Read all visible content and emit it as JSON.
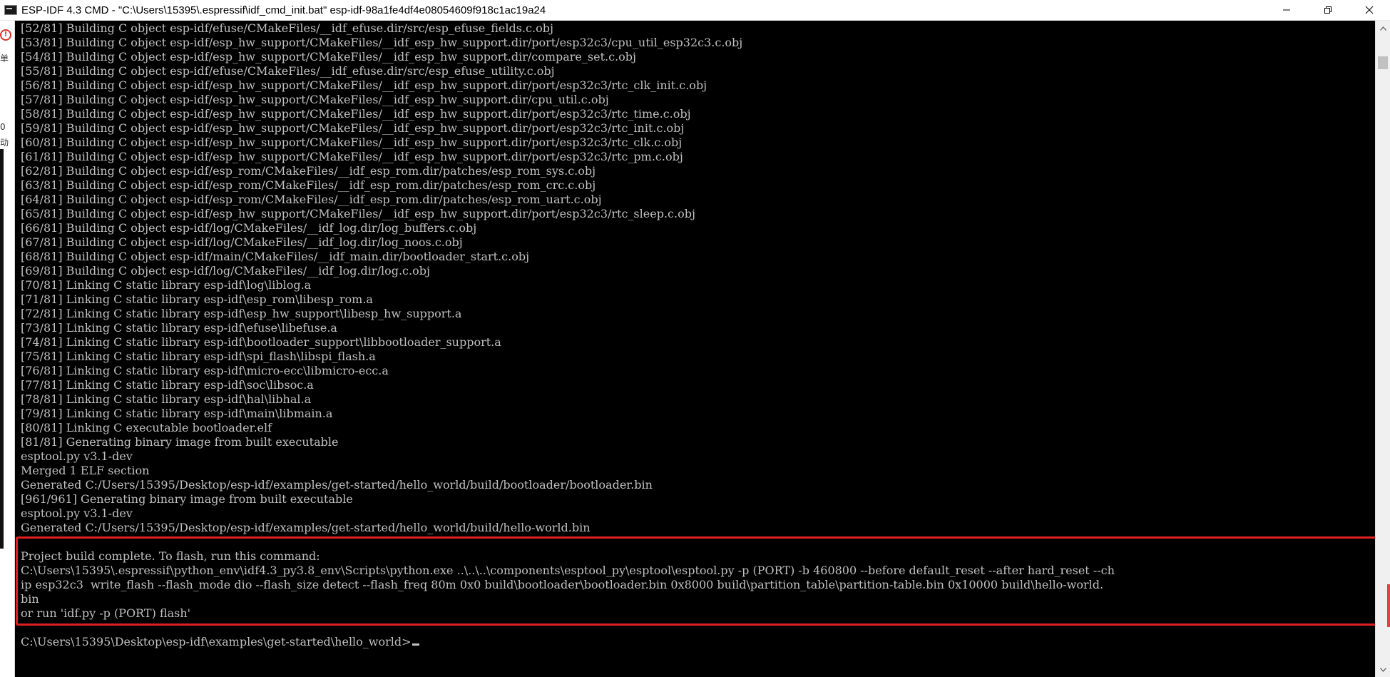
{
  "window": {
    "title": "ESP-IDF 4.3 CMD - \"C:\\Users\\15395\\.espressif\\idf_cmd_init.bat\"  esp-idf-98a1fe4df4e08054609f918c1ac19a24",
    "app_icon": "cmd-console-icon",
    "controls": {
      "minimize_icon": "minimize-icon",
      "restore_icon": "restore-icon",
      "close_icon": "close-icon"
    }
  },
  "left_strip": {
    "glyphs": [
      "单",
      "0",
      "动"
    ]
  },
  "console": {
    "lines": [
      "[52/81] Building C object esp-idf/efuse/CMakeFiles/__idf_efuse.dir/src/esp_efuse_fields.c.obj",
      "[53/81] Building C object esp-idf/esp_hw_support/CMakeFiles/__idf_esp_hw_support.dir/port/esp32c3/cpu_util_esp32c3.c.obj",
      "[54/81] Building C object esp-idf/esp_hw_support/CMakeFiles/__idf_esp_hw_support.dir/compare_set.c.obj",
      "[55/81] Building C object esp-idf/efuse/CMakeFiles/__idf_efuse.dir/src/esp_efuse_utility.c.obj",
      "[56/81] Building C object esp-idf/esp_hw_support/CMakeFiles/__idf_esp_hw_support.dir/port/esp32c3/rtc_clk_init.c.obj",
      "[57/81] Building C object esp-idf/esp_hw_support/CMakeFiles/__idf_esp_hw_support.dir/cpu_util.c.obj",
      "[58/81] Building C object esp-idf/esp_hw_support/CMakeFiles/__idf_esp_hw_support.dir/port/esp32c3/rtc_time.c.obj",
      "[59/81] Building C object esp-idf/esp_hw_support/CMakeFiles/__idf_esp_hw_support.dir/port/esp32c3/rtc_init.c.obj",
      "[60/81] Building C object esp-idf/esp_hw_support/CMakeFiles/__idf_esp_hw_support.dir/port/esp32c3/rtc_clk.c.obj",
      "[61/81] Building C object esp-idf/esp_hw_support/CMakeFiles/__idf_esp_hw_support.dir/port/esp32c3/rtc_pm.c.obj",
      "[62/81] Building C object esp-idf/esp_rom/CMakeFiles/__idf_esp_rom.dir/patches/esp_rom_sys.c.obj",
      "[63/81] Building C object esp-idf/esp_rom/CMakeFiles/__idf_esp_rom.dir/patches/esp_rom_crc.c.obj",
      "[64/81] Building C object esp-idf/esp_rom/CMakeFiles/__idf_esp_rom.dir/patches/esp_rom_uart.c.obj",
      "[65/81] Building C object esp-idf/esp_hw_support/CMakeFiles/__idf_esp_hw_support.dir/port/esp32c3/rtc_sleep.c.obj",
      "[66/81] Building C object esp-idf/log/CMakeFiles/__idf_log.dir/log_buffers.c.obj",
      "[67/81] Building C object esp-idf/log/CMakeFiles/__idf_log.dir/log_noos.c.obj",
      "[68/81] Building C object esp-idf/main/CMakeFiles/__idf_main.dir/bootloader_start.c.obj",
      "[69/81] Building C object esp-idf/log/CMakeFiles/__idf_log.dir/log.c.obj",
      "[70/81] Linking C static library esp-idf\\log\\liblog.a",
      "[71/81] Linking C static library esp-idf\\esp_rom\\libesp_rom.a",
      "[72/81] Linking C static library esp-idf\\esp_hw_support\\libesp_hw_support.a",
      "[73/81] Linking C static library esp-idf\\efuse\\libefuse.a",
      "[74/81] Linking C static library esp-idf\\bootloader_support\\libbootloader_support.a",
      "[75/81] Linking C static library esp-idf\\spi_flash\\libspi_flash.a",
      "[76/81] Linking C static library esp-idf\\micro-ecc\\libmicro-ecc.a",
      "[77/81] Linking C static library esp-idf\\soc\\libsoc.a",
      "[78/81] Linking C static library esp-idf\\hal\\libhal.a",
      "[79/81] Linking C static library esp-idf\\main\\libmain.a",
      "[80/81] Linking C executable bootloader.elf",
      "[81/81] Generating binary image from built executable",
      "esptool.py v3.1-dev",
      "Merged 1 ELF section",
      "Generated C:/Users/15395/Desktop/esp-idf/examples/get-started/hello_world/build/bootloader/bootloader.bin",
      "[961/961] Generating binary image from built executable",
      "esptool.py v3.1-dev",
      "Generated C:/Users/15395/Desktop/esp-idf/examples/get-started/hello_world/build/hello-world.bin",
      "",
      "Project build complete. To flash, run this command:",
      "C:\\Users\\15395\\.espressif\\python_env\\idf4.3_py3.8_env\\Scripts\\python.exe ..\\..\\..\\components\\esptool_py\\esptool\\esptool.py -p (PORT) -b 460800 --before default_reset --after hard_reset --ch",
      "ip esp32c3  write_flash --flash_mode dio --flash_size detect --flash_freq 80m 0x0 build\\bootloader\\bootloader.bin 0x8000 build\\partition_table\\partition-table.bin 0x10000 build\\hello-world.",
      "bin",
      "or run 'idf.py -p (PORT) flash'",
      "",
      "C:\\Users\\15395\\Desktop\\esp-idf\\examples\\get-started\\hello_world>"
    ]
  },
  "colors": {
    "console_bg": "#000000",
    "console_text": "#c0c0c0",
    "highlight_border": "#e02020"
  }
}
